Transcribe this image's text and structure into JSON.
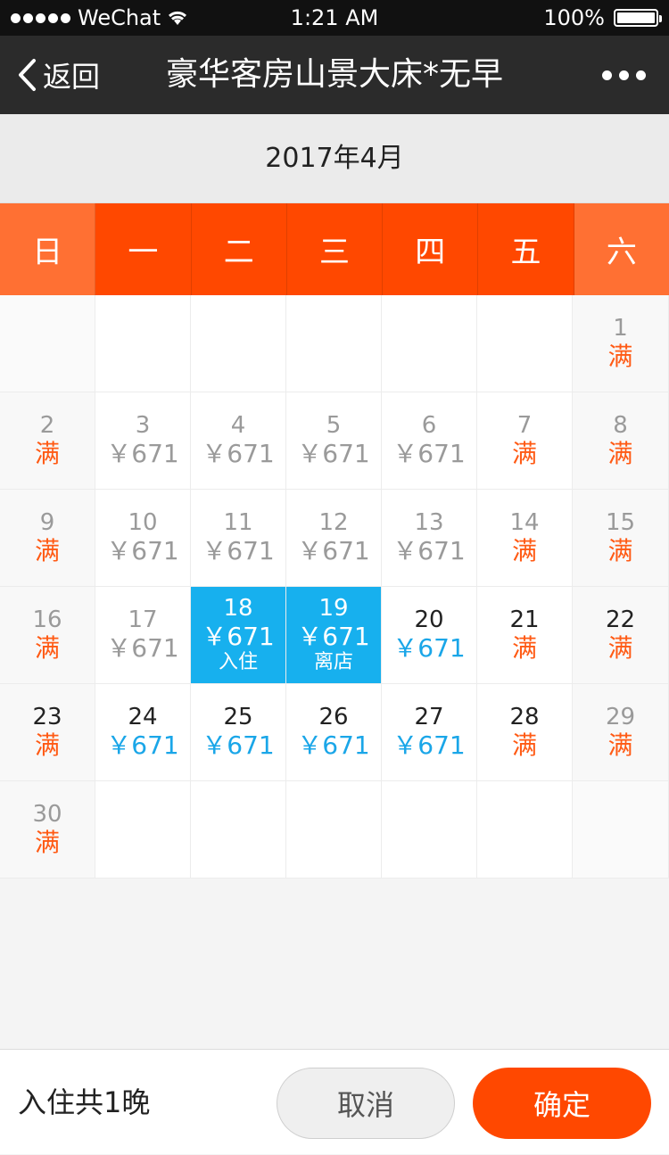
{
  "status": {
    "carrier": "WeChat",
    "time": "1:21 AM",
    "battery": "100%"
  },
  "nav": {
    "back_label": "返回",
    "title": "豪华客房山景大床*无早",
    "back_icon": "chevron-left-icon",
    "more_icon": "more-dots-icon"
  },
  "calendar": {
    "month_label": "2017年4月",
    "weekdays": [
      "日",
      "一",
      "二",
      "三",
      "四",
      "五",
      "六"
    ],
    "colors": {
      "weekday_header": "#ff4800",
      "weekend_header": "#ff7033",
      "selected": "#17b0ee",
      "price_available": "#1aa6e8",
      "full": "#ff5a14"
    },
    "days": [
      {
        "day": "",
        "value": ""
      },
      {
        "day": "",
        "value": ""
      },
      {
        "day": "",
        "value": ""
      },
      {
        "day": "",
        "value": ""
      },
      {
        "day": "",
        "value": ""
      },
      {
        "day": "",
        "value": ""
      },
      {
        "day": "1",
        "value": "满",
        "state": "past"
      },
      {
        "day": "2",
        "value": "满",
        "state": "past"
      },
      {
        "day": "3",
        "value": "￥671",
        "state": "past"
      },
      {
        "day": "4",
        "value": "￥671",
        "state": "past"
      },
      {
        "day": "5",
        "value": "￥671",
        "state": "past"
      },
      {
        "day": "6",
        "value": "￥671",
        "state": "past"
      },
      {
        "day": "7",
        "value": "满",
        "state": "past"
      },
      {
        "day": "8",
        "value": "满",
        "state": "past"
      },
      {
        "day": "9",
        "value": "满",
        "state": "past"
      },
      {
        "day": "10",
        "value": "￥671",
        "state": "past"
      },
      {
        "day": "11",
        "value": "￥671",
        "state": "past"
      },
      {
        "day": "12",
        "value": "￥671",
        "state": "past"
      },
      {
        "day": "13",
        "value": "￥671",
        "state": "past"
      },
      {
        "day": "14",
        "value": "满",
        "state": "past"
      },
      {
        "day": "15",
        "value": "满",
        "state": "past"
      },
      {
        "day": "16",
        "value": "满",
        "state": "past"
      },
      {
        "day": "17",
        "value": "￥671",
        "state": "past"
      },
      {
        "day": "18",
        "value": "￥671",
        "state": "selected",
        "tag": "入住"
      },
      {
        "day": "19",
        "value": "￥671",
        "state": "selected",
        "tag": "离店"
      },
      {
        "day": "20",
        "value": "￥671",
        "state": "available"
      },
      {
        "day": "21",
        "value": "满",
        "state": "available"
      },
      {
        "day": "22",
        "value": "满",
        "state": "available"
      },
      {
        "day": "23",
        "value": "满",
        "state": "available"
      },
      {
        "day": "24",
        "value": "￥671",
        "state": "available"
      },
      {
        "day": "25",
        "value": "￥671",
        "state": "available"
      },
      {
        "day": "26",
        "value": "￥671",
        "state": "available"
      },
      {
        "day": "27",
        "value": "￥671",
        "state": "available"
      },
      {
        "day": "28",
        "value": "满",
        "state": "available"
      },
      {
        "day": "29",
        "value": "满",
        "state": "past"
      },
      {
        "day": "30",
        "value": "满",
        "state": "past"
      },
      {
        "day": "",
        "value": ""
      },
      {
        "day": "",
        "value": ""
      },
      {
        "day": "",
        "value": ""
      },
      {
        "day": "",
        "value": ""
      },
      {
        "day": "",
        "value": ""
      },
      {
        "day": "",
        "value": ""
      }
    ]
  },
  "footer": {
    "nights_label": "入住共1晚",
    "cancel_label": "取消",
    "confirm_label": "确定"
  }
}
